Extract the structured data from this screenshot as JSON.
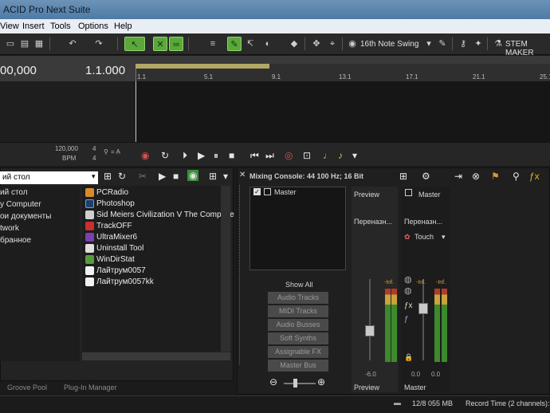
{
  "window": {
    "title": "ACID Pro Next Suite"
  },
  "menu": [
    "View",
    "Insert",
    "Tools",
    "Options",
    "Help"
  ],
  "toolbar": {
    "swing": "16th Note Swing",
    "stem": "STEM MAKER"
  },
  "timeline": {
    "time_display": "00,000",
    "measure_display": "1.1.000",
    "ticks": [
      "1.1",
      "5.1",
      "9.1",
      "13.1",
      "17.1",
      "21.1",
      "25.1"
    ]
  },
  "tempo": {
    "bpm_value": "120,000",
    "bpm_label": "BPM",
    "time_sig_top": "4",
    "time_sig_bottom": "4",
    "key": "= A"
  },
  "explorer": {
    "address": "ий стол",
    "tree": [
      "ий стол",
      "y Computer",
      "ои документы",
      "twork",
      "бранное"
    ],
    "files": [
      "PCRadio",
      "Photoshop",
      "Sid Meiers Civilization V The Complete",
      "TrackOFF",
      "UltraMixer6",
      "Uninstall Tool",
      "WinDirStat",
      "Лайтрум0057",
      "Лайтрум0057kk"
    ],
    "tabs": [
      "Groove Pool",
      "Plug-In Manager"
    ]
  },
  "mixer": {
    "title": "Mixing Console: 44 100 Hz; 16 Bit",
    "master_checkbox_label": "Master",
    "show_all": "Show All",
    "filters": [
      "Audio Tracks",
      "MIDI Tracks",
      "Audio Busses",
      "Soft Synths",
      "Assignable FX",
      "Master Bus"
    ],
    "preview": {
      "label": "Preview",
      "route": "Переназн...",
      "level_left": "-Inf.",
      "level_right": "-6.0",
      "footer": "Preview"
    },
    "master": {
      "label": "Master",
      "route": "Переназн...",
      "automation": "Touch",
      "level_left": "-Inf.",
      "level_right": "-Inf.",
      "read_left": "0.0",
      "read_right": "0.0",
      "footer": "Master"
    }
  },
  "status": {
    "memory": "12/8 055 MB",
    "record_time": "Record Time (2 channels):"
  }
}
